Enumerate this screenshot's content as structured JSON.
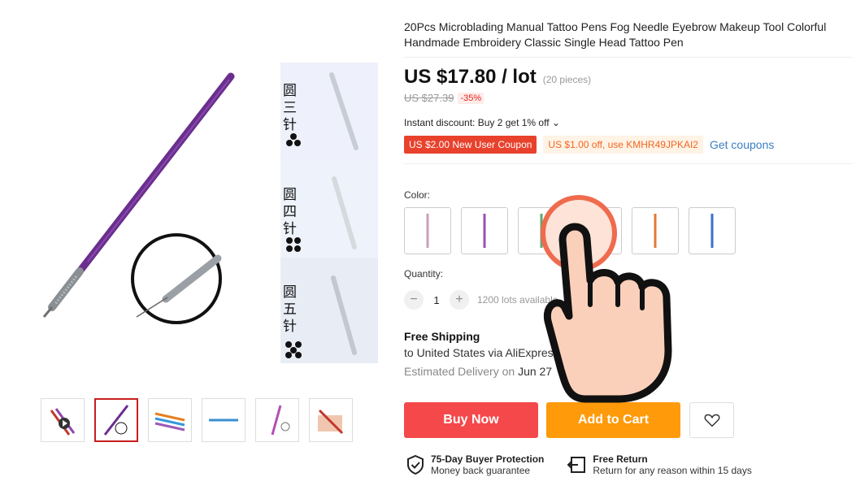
{
  "product": {
    "title": "20Pcs Microblading Manual Tattoo Pens Fog Needle Eyebrow Makeup Tool Colorful Handmade Embroidery Classic Single Head Tattoo Pen",
    "price": "US $17.80 / lot",
    "pieces": "(20 pieces)",
    "old_price": "US $27.39",
    "discount": "-35%",
    "instant_discount": "Instant discount: Buy 2 get 1% off ⌄"
  },
  "coupons": {
    "new_user": "US $2.00 New User Coupon",
    "code_offer": "US $1.00 off, use KMHR49JPKAI2",
    "get_coupons": "Get coupons"
  },
  "gallery": {
    "side_labels": [
      "圆三针",
      "圆四针",
      "圆五针"
    ]
  },
  "color": {
    "label": "Color:",
    "swatch_colors": [
      "#c8a0b8",
      "#9b4fb5",
      "#5fa874",
      "#888888",
      "#e07a3a",
      "#3a6fd0"
    ]
  },
  "quantity": {
    "label": "Quantity:",
    "minus": "−",
    "value": "1",
    "plus": "+",
    "available": "1200 lots available"
  },
  "shipping": {
    "title": "Free Shipping",
    "to": "to United States via AliExpress Standard Shipping ⌄",
    "estimate_label": "Estimated Delivery on ",
    "estimate_date": "Jun 27"
  },
  "actions": {
    "buy_now": "Buy Now",
    "add_to_cart": "Add to Cart"
  },
  "guarantees": {
    "protection_title": "75-Day Buyer Protection",
    "protection_sub": "Money back guarantee",
    "return_title": "Free Return",
    "return_sub": "Return for any reason within 15 days"
  },
  "colors": {
    "buy": "#f5484a",
    "cart": "#ff9a0a",
    "coupon": "#e8412c",
    "link": "#3a7fc4",
    "pen_purple": "#6a2e8e"
  }
}
